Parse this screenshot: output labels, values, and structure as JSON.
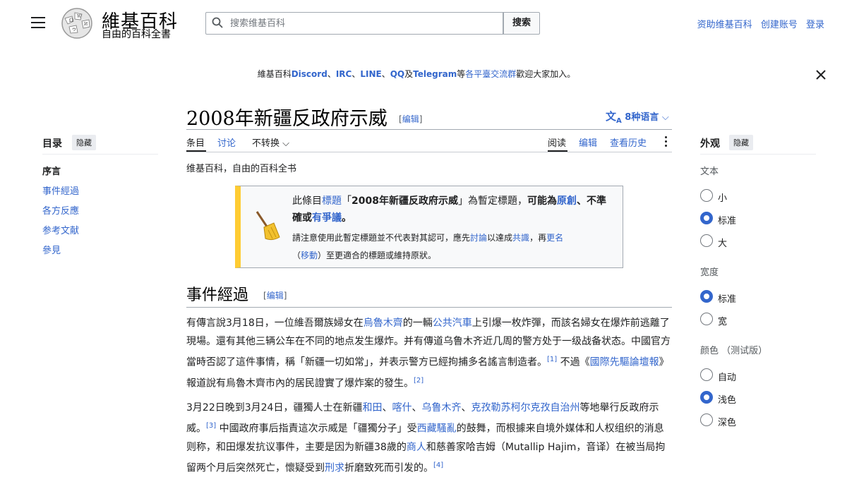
{
  "header": {
    "logo_title": "維基百科",
    "logo_subtitle": "自由的百科全書",
    "search_placeholder": "搜索维基百科",
    "search_button": "搜索",
    "user_links": [
      "资助维基百科",
      "创建账号",
      "登录"
    ]
  },
  "banner": {
    "prefix": "維基百科",
    "links": [
      "Discord",
      "IRC",
      "LINE",
      "QQ",
      "Telegram"
    ],
    "sep": "、",
    "conj": "及",
    "mid": "等",
    "mid_link": "各平臺交流群",
    "suffix": "歡迎大家加入。"
  },
  "article": {
    "title": "2008年新疆反政府示威",
    "edit_label": "编辑",
    "lang_button": "8种语言",
    "tabs_left": [
      "条目",
      "讨论"
    ],
    "variant": "不转换",
    "tabs_right": [
      "阅读",
      "编辑",
      "查看历史"
    ],
    "site_sub": "维基百科，自由的百科全书"
  },
  "toc": {
    "title": "目录",
    "hide": "隐藏",
    "items": [
      "序言",
      "事件經過",
      "各方反應",
      "参考文献",
      "參見"
    ]
  },
  "notice": {
    "line1_a": "此條目",
    "line1_link": "標題",
    "line1_b": "「",
    "line1_title": "2008年新疆反政府示威",
    "line1_c": "」為暫定標題，",
    "line1_d": "可能為",
    "line1_link2": "原創",
    "line1_e": "、不準確或",
    "line1_link3": "有爭議",
    "line1_f": "。",
    "line2_a": "請注意使用此暫定標題並不代表對其認可，應先",
    "line2_link1": "討論",
    "line2_b": "以達成",
    "line2_link2": "共識",
    "line2_c": "，再",
    "line2_link3": "更名",
    "line2_d": "（",
    "line2_link4": "移動",
    "line2_e": "）至更適合的標題或維持原狀。"
  },
  "section1": {
    "heading": "事件經過",
    "edit_label": "编辑"
  },
  "para1": {
    "t1": "有傳言說3月18日，一位維吾爾族婦女在",
    "l1": "烏魯木齊",
    "t2": "的一輛",
    "l2": "公共汽車",
    "t3": "上引爆一枚炸彈，而該名婦女在爆炸前逃離了現場。還有其他三辆公车在不同的地点发生爆炸。并有傳道乌鲁木齐近几周的警方处于一级战备状态。中國官方當時否認了這件事情，稱「新疆一切如常」，并表示警方已經拘捕多名謠言制造者。",
    "ref1": "[1]",
    "t4": " 不過《",
    "l3": "國際先驅論壇報",
    "t5": "》報道說有烏魯木齊市內的居民證實了爆炸案的發生。",
    "ref2": "[2]"
  },
  "para2": {
    "t1": "3月22日晚到3月24日，疆獨人士在新疆",
    "l1": "和田",
    "s1": "、",
    "l2": "喀什",
    "s2": "、",
    "l3": "乌鲁木齐",
    "s3": "、",
    "l4": "克孜勒苏柯尔克孜自治州",
    "t2": "等地舉行反政府示威。",
    "ref1": "[3]",
    "t3": " 中國政府事后指責這次示威是「疆獨分子」受",
    "l5": "西藏騷亂",
    "t4": "的鼓舞，而根據来自境外媒体和人权组织的消息则称，和田爆发抗议事件，主要是因为新疆38歲的",
    "l6": "商人",
    "t5": "和慈善家哈吉姆（Mutallip Hajim，音译）在被当局拘留两个月后突然死亡，懷疑受到",
    "l7": "刑求",
    "t6": "折磨致死而引发的。",
    "ref2": "[4]"
  },
  "appearance": {
    "title": "外观",
    "hide": "隐藏",
    "text_label": "文本",
    "text_options": [
      "小",
      "标准",
      "大"
    ],
    "text_selected": "标准",
    "width_label": "宽度",
    "width_options": [
      "标准",
      "宽"
    ],
    "width_selected": "标准",
    "color_label": "颜色 （测试版）",
    "color_options": [
      "自动",
      "浅色",
      "深色"
    ],
    "color_selected": "浅色"
  },
  "colors": {
    "link": "#3366cc",
    "notice_bar": "#ffcc33",
    "text": "#202122"
  }
}
